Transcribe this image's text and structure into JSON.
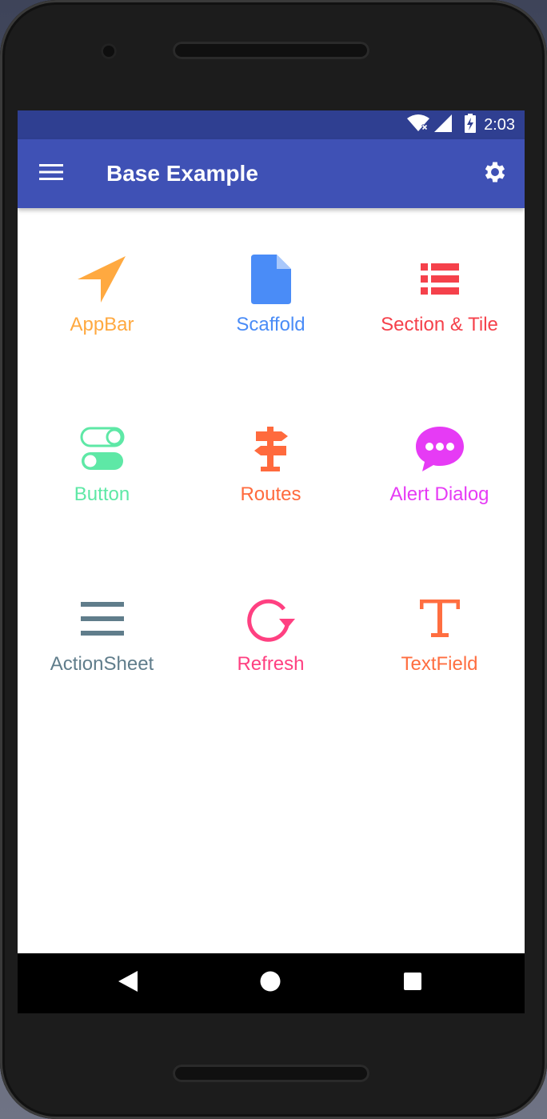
{
  "status_bar": {
    "time": "2:03",
    "icons": [
      "wifi-icon",
      "signal-icon",
      "battery-charging-icon"
    ]
  },
  "app_bar": {
    "title": "Base Example",
    "menu_icon": "menu-icon",
    "settings_icon": "settings-icon",
    "color": "#3f51b5",
    "status_color": "#2f3f91"
  },
  "grid": {
    "items": [
      {
        "label": "AppBar",
        "icon": "navigation-arrow-icon",
        "color": "#FFA940"
      },
      {
        "label": "Scaffold",
        "icon": "file-icon",
        "color": "#4A8CF7"
      },
      {
        "label": "Section & Tile",
        "icon": "list-icon",
        "color": "#F5414B"
      },
      {
        "label": "Button",
        "icon": "toggle-icon",
        "color": "#5EE8A6"
      },
      {
        "label": "Routes",
        "icon": "signpost-icon",
        "color": "#FF6A3D"
      },
      {
        "label": "Alert Dialog",
        "icon": "chat-bubble-icon",
        "color": "#E63BF5"
      },
      {
        "label": "ActionSheet",
        "icon": "menu-lines-icon",
        "color": "#607D8B"
      },
      {
        "label": "Refresh",
        "icon": "refresh-icon",
        "color": "#FF4081"
      },
      {
        "label": "TextField",
        "icon": "text-icon",
        "color": "#FF6E40"
      }
    ]
  },
  "nav_bar": {
    "back_icon": "back-triangle-icon",
    "home_icon": "home-circle-icon",
    "recents_icon": "recents-square-icon"
  }
}
